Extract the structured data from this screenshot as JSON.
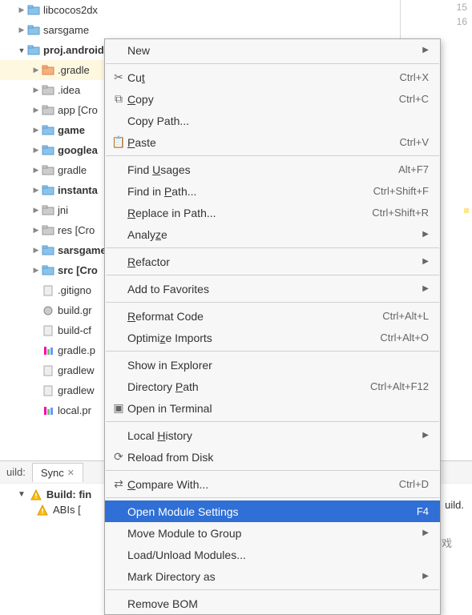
{
  "gutter": {
    "line1": "15",
    "line2": "16"
  },
  "tree": {
    "r0": "libcocos2dx",
    "r1": "sarsgame",
    "r2": "proj.android_studio",
    "r3": ".gradle",
    "r4": ".idea",
    "r5": "app [Cro",
    "r6": "game",
    "r7": "googlea",
    "r8": "gradle",
    "r9": "instanta",
    "r10": "jni",
    "r11": "res [Cro",
    "r12": "sarsgame",
    "r13": "src [Cro",
    "r14": ".gitigno",
    "r15": "build.gr",
    "r16": "build-cf",
    "r17": "gradle.p",
    "r18": "gradlew",
    "r19": "gradlew",
    "r20": "local.pr"
  },
  "bottom": {
    "label": "uild:",
    "tab": "Sync",
    "build_fin": "Build: fin",
    "abis": "ABIs [",
    "abis_tail": "uild."
  },
  "watermark": "微笑游戏",
  "menu": {
    "new": "New",
    "cut": {
      "label": "Cut",
      "u": "t",
      "sc": "Ctrl+X"
    },
    "copy": {
      "label": "Copy",
      "u": "C",
      "sc": "Ctrl+C"
    },
    "copypath": "Copy Path...",
    "paste": {
      "label": "Paste",
      "u": "P",
      "sc": "Ctrl+V"
    },
    "findusages": {
      "label": "Find Usages",
      "u": "U",
      "sc": "Alt+F7"
    },
    "findinpath": {
      "label": "Find in Path...",
      "u": "P",
      "sc": "Ctrl+Shift+F"
    },
    "replaceinpath": {
      "label": "Replace in Path...",
      "u": "R",
      "sc": "Ctrl+Shift+R"
    },
    "analyze": {
      "label": "Analyze",
      "u": "z"
    },
    "refactor": {
      "label": "Refactor",
      "u": "R"
    },
    "addfav": "Add to Favorites",
    "reformat": {
      "label": "Reformat Code",
      "u": "R",
      "sc": "Ctrl+Alt+L"
    },
    "optimize": {
      "label": "Optimize Imports",
      "u": "z",
      "sc": "Ctrl+Alt+O"
    },
    "showexpl": "Show in Explorer",
    "dirpath": {
      "label": "Directory Path",
      "u": "P",
      "sc": "Ctrl+Alt+F12"
    },
    "terminal": "Open in Terminal",
    "localhist": {
      "label": "Local History",
      "u": "H"
    },
    "reload": "Reload from Disk",
    "compare": {
      "label": "Compare With...",
      "u": "C",
      "sc": "Ctrl+D"
    },
    "openmodule": {
      "label": "Open Module Settings",
      "sc": "F4"
    },
    "movemodule": "Move Module to Group",
    "loadunload": "Load/Unload Modules...",
    "markdir": "Mark Directory as",
    "removebom": "Remove BOM"
  }
}
